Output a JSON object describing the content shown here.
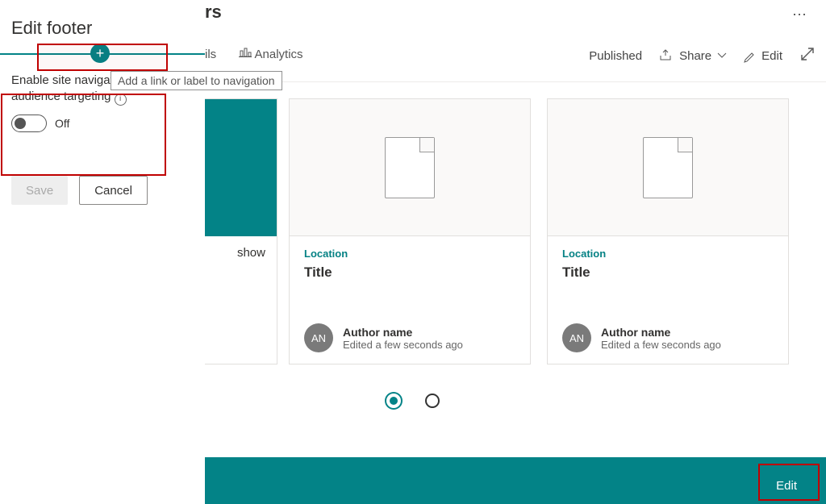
{
  "panel": {
    "title": "Edit footer",
    "tooltip": "Add a link or label to navigation",
    "audience_label_line1": "Enable site navigation",
    "audience_label_line2": "audience targeting",
    "toggle_state": "Off",
    "save_label": "Save",
    "cancel_label": "Cancel"
  },
  "page": {
    "title_fragment": "rs",
    "tab1_fragment": "ils",
    "tab2": "Analytics",
    "status": "Published",
    "share": "Share",
    "edit": "Edit",
    "first_card_text": "show"
  },
  "cards": [
    {
      "location": "Location",
      "title": "Title",
      "avatar": "AN",
      "author": "Author name",
      "edited": "Edited a few seconds ago"
    },
    {
      "location": "Location",
      "title": "Title",
      "avatar": "AN",
      "author": "Author name",
      "edited": "Edited a few seconds ago"
    }
  ],
  "footer": {
    "edit": "Edit"
  }
}
